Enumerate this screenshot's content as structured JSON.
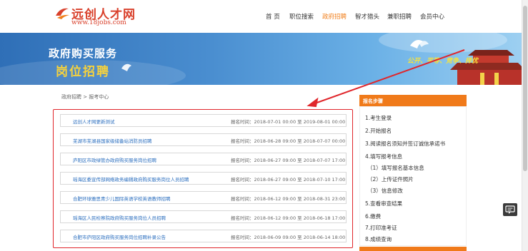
{
  "header": {
    "logo_name": "远创人才网",
    "logo_url": "www.18jobs.com",
    "nav": [
      {
        "label": "首 页",
        "active": false
      },
      {
        "label": "职位搜索",
        "active": false
      },
      {
        "label": "政府招聘",
        "active": true
      },
      {
        "label": "智才猎头",
        "active": false
      },
      {
        "label": "兼职招聘",
        "active": false
      },
      {
        "label": "会员中心",
        "active": false
      }
    ]
  },
  "banner": {
    "line1": "政府购买服务",
    "line2": "岗位招聘",
    "slogan": "公开、平等、竞争、择优"
  },
  "breadcrumb": "政府招聘 > 报考中心",
  "list": {
    "date_label": "报名时间：",
    "rows": [
      {
        "title": "远创人才网更新测试",
        "date": "2018-07-01 00:00 至 2019-08-01 00:00"
      },
      {
        "title": "芜湖市芜湖县国家级储备站消防员招聘",
        "date": "2018-06-28 09:00 至 2018-07-07 00:00"
      },
      {
        "title": "庐阳区市政绿管办政府购买服务岗位招聘",
        "date": "2018-06-27 09:00 至 2018-07-07 17:00"
      },
      {
        "title": "瑶海区委宣传部网络政务编辑政府购买服务岗位人员招聘",
        "date": "2018-06-27 09:00 至 2018-07-10 17:00"
      },
      {
        "title": "合肥环球雅思青少儿国际英语学校英语教师招聘",
        "date": "2018-06-12 09:00 至 2018-08-31 23:00"
      },
      {
        "title": "瑶海区人民检察院政府购买服务岗位人员招聘",
        "date": "2018-06-12 09:00 至 2018-06-18 17:00"
      },
      {
        "title": "合肥市庐阳区政府购买服务岗位招聘补录公告",
        "date": "2018-06-09 09:00 至 2018-06-14 18:00"
      }
    ]
  },
  "sidebar": {
    "title": "报名步骤",
    "steps": [
      "1.考生登录",
      "2.开始报名",
      "3.阅读报名须知并签订诚信承诺书",
      "4.填写报考信息",
      "（1）填写报名基本信息",
      "（2）上传证件照片",
      "（3）信息修改",
      "5.查看审查结果",
      "6.缴费",
      "7.打印准考证",
      "8.成绩查询"
    ]
  },
  "colors": {
    "accent": "#f07f1c",
    "brand": "#d9412c",
    "link": "#2c6fbf",
    "highlight_box": "#e0262b",
    "arrow": "#e0262b"
  }
}
